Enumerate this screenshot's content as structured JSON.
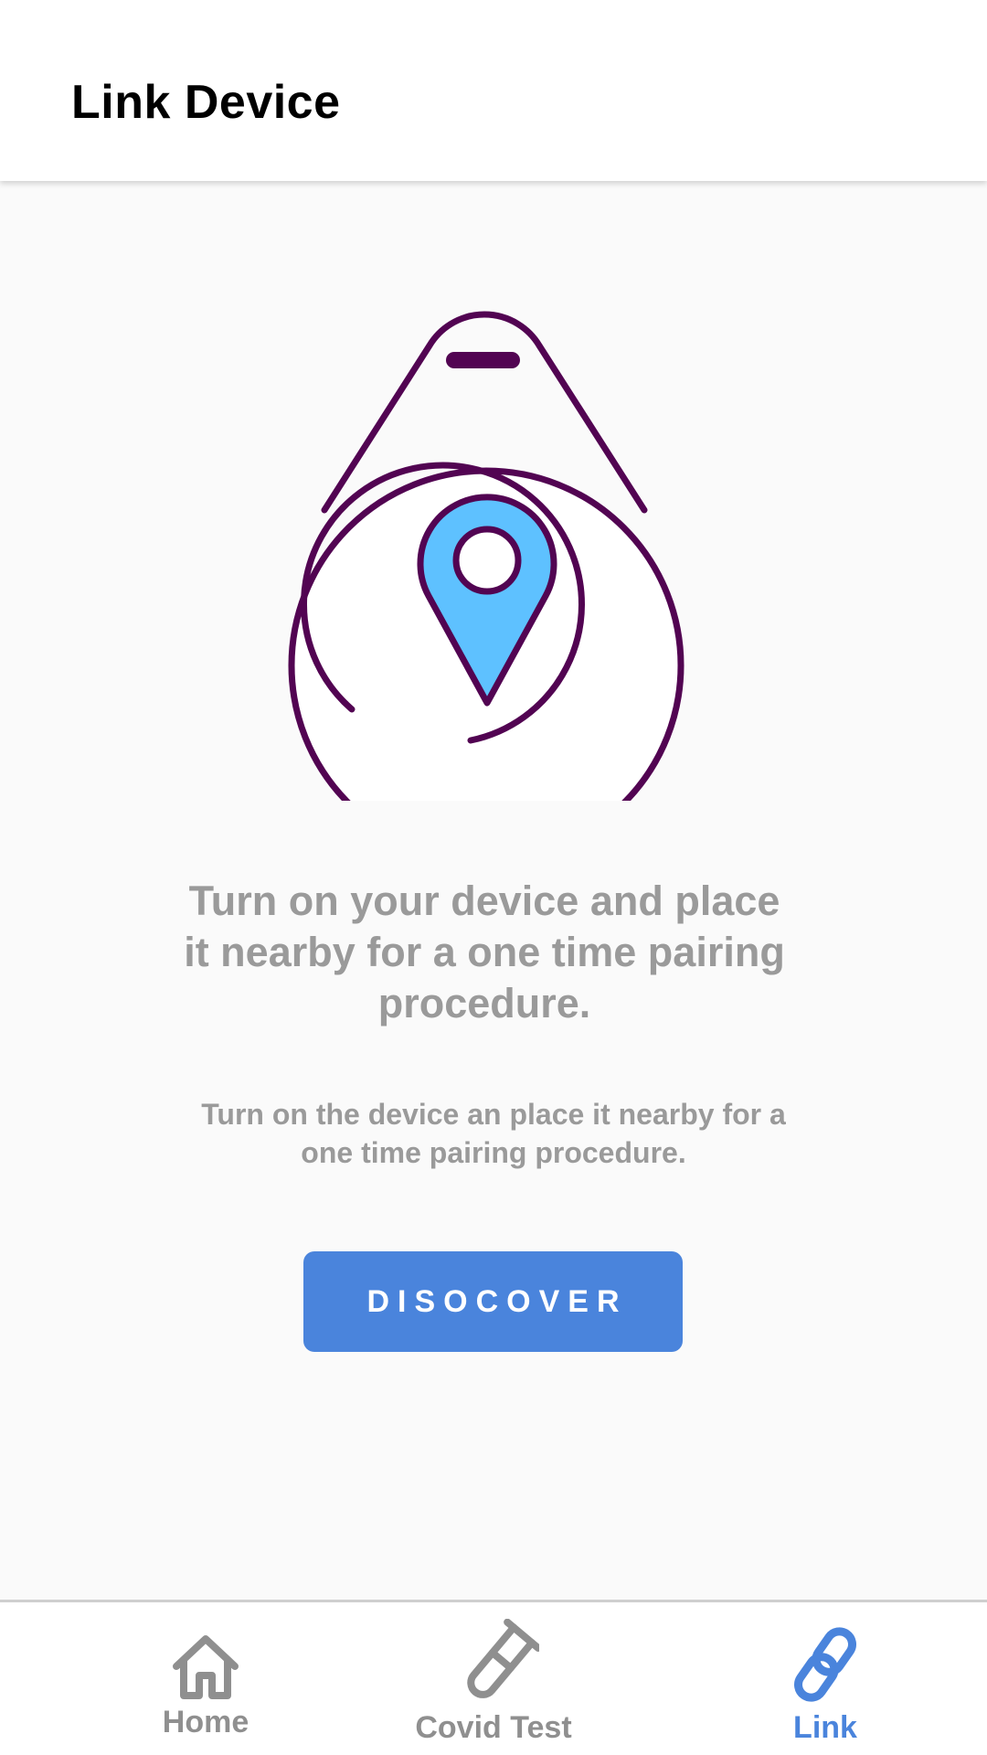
{
  "app_bar": {
    "title": "Link Device"
  },
  "main": {
    "illustration_icon": "location-tracker-tag-icon",
    "headline": "Turn on your device and place it nearby for a one time pairing procedure.",
    "subtext": "Turn on the device an place it nearby for a one time pairing procedure.",
    "discover_label": "DISOCOVER"
  },
  "bottom_nav": {
    "items": [
      {
        "label": "Home",
        "icon": "home-icon",
        "active": false
      },
      {
        "label": "Covid Test",
        "icon": "test-tube-icon",
        "active": false
      },
      {
        "label": "Link",
        "icon": "link-icon",
        "active": true
      }
    ]
  },
  "colors": {
    "accent": "#4a84dc",
    "illustration_stroke": "#520452",
    "illustration_fill": "#5ec1ff",
    "muted_text": "#9a9a9a",
    "nav_inactive": "#8f8f8f"
  }
}
